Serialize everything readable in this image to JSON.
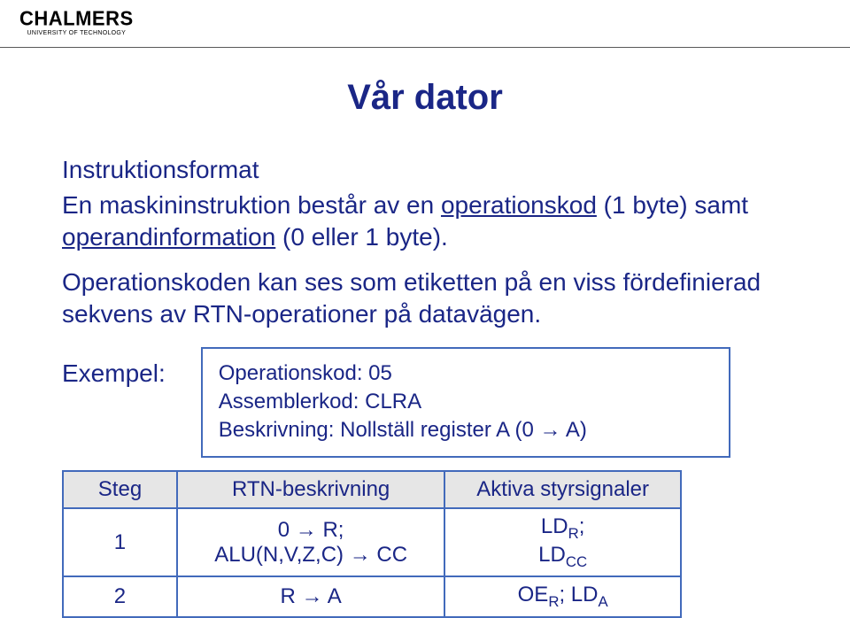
{
  "logo": {
    "main": "CHALMERS",
    "sub": "UNIVERSITY OF TECHNOLOGY"
  },
  "title": "Vår dator",
  "subhead": "Instruktionsformat",
  "para1_a": "En maskininstruktion består av en ",
  "para1_link": "operationskod",
  "para1_b": " (1 byte) samt ",
  "para1_c": "operandinformation",
  "para1_d": " (0 eller 1 byte).",
  "para2": "Operationskoden kan ses som etiketten på en viss fördefinierad sekvens av RTN-operationer på datavägen.",
  "example_label": "Exempel:",
  "box": {
    "l1": "Operationskod: 05",
    "l2": "Assemblerkod: CLRA",
    "l3": "Beskrivning: Nollställ register A  (0 → A)"
  },
  "table": {
    "h1": "Steg",
    "h2": "RTN-beskrivning",
    "h3": "Aktiva styrsignaler",
    "r1c1": "1",
    "r1c2a": "0 → R;",
    "r1c2b": "ALU(N,V,Z,C) → CC",
    "r1c3a": "LD",
    "r1c3a_sub": "R",
    "r1c3a_after": ";",
    "r1c3b": "LD",
    "r1c3b_sub": "CC",
    "r2c1": "2",
    "r2c2": "R → A",
    "r2c3a": "OE",
    "r2c3a_sub": "R",
    "r2c3a_after": "; LD",
    "r2c3b_sub": "A"
  }
}
